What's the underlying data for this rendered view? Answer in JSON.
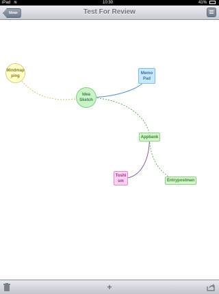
{
  "status_bar": {
    "carrier": "iPad",
    "time": "10:30",
    "battery": "41%"
  },
  "nav": {
    "title": "Test For Review",
    "back_label": "Ideas"
  },
  "mindmap": {
    "nodes": [
      {
        "id": "mindmapping",
        "label": "Mindmap ping",
        "shape": "circle",
        "fill": "#ffffc8",
        "border": "#d9d38a",
        "text_color": "#8a7a2a"
      },
      {
        "id": "idea-sketch",
        "label": "Idea Sketch",
        "shape": "circle",
        "fill": "#c9f2c9",
        "border": "#7fcf7f",
        "text_color": "#3f7f3f"
      },
      {
        "id": "memo-pad",
        "label": "Memo Pad",
        "shape": "rect",
        "fill": "#c8e8ff",
        "border": "#7fbde6",
        "text_color": "#3d6f94"
      },
      {
        "id": "appbank",
        "label": "Appbank",
        "shape": "rect",
        "fill": "#d3f5c8",
        "border": "#8fd58a",
        "text_color": "#3f7f3f"
      },
      {
        "id": "toshism",
        "label": "Toshi sm",
        "shape": "rect",
        "fill": "#ffd0f4",
        "border": "#e08ed3",
        "text_color": "#8a3f7e"
      },
      {
        "id": "entrypostman",
        "label": "Entrypostman",
        "shape": "rect",
        "fill": "#d3f5c8",
        "border": "#8fd58a",
        "text_color": "#3f7f3f"
      }
    ],
    "edges": [
      {
        "from": "idea-sketch",
        "to": "mindmapping",
        "color": "#e0c070",
        "style": "dashed"
      },
      {
        "from": "idea-sketch",
        "to": "memo-pad",
        "color": "#5a8fd0",
        "style": "solid"
      },
      {
        "from": "idea-sketch",
        "to": "appbank",
        "color": "#5cb85c",
        "style": "dashed"
      },
      {
        "from": "appbank",
        "to": "toshism",
        "color": "#8a5aa8",
        "style": "solid"
      },
      {
        "from": "appbank",
        "to": "entrypostman",
        "color": "#5cb85c",
        "style": "dashed"
      }
    ]
  },
  "toolbar": {
    "left_icon": "trash-icon",
    "center_icon": "add-icon",
    "center_glyph": "+",
    "right_icon": "share-icon"
  }
}
